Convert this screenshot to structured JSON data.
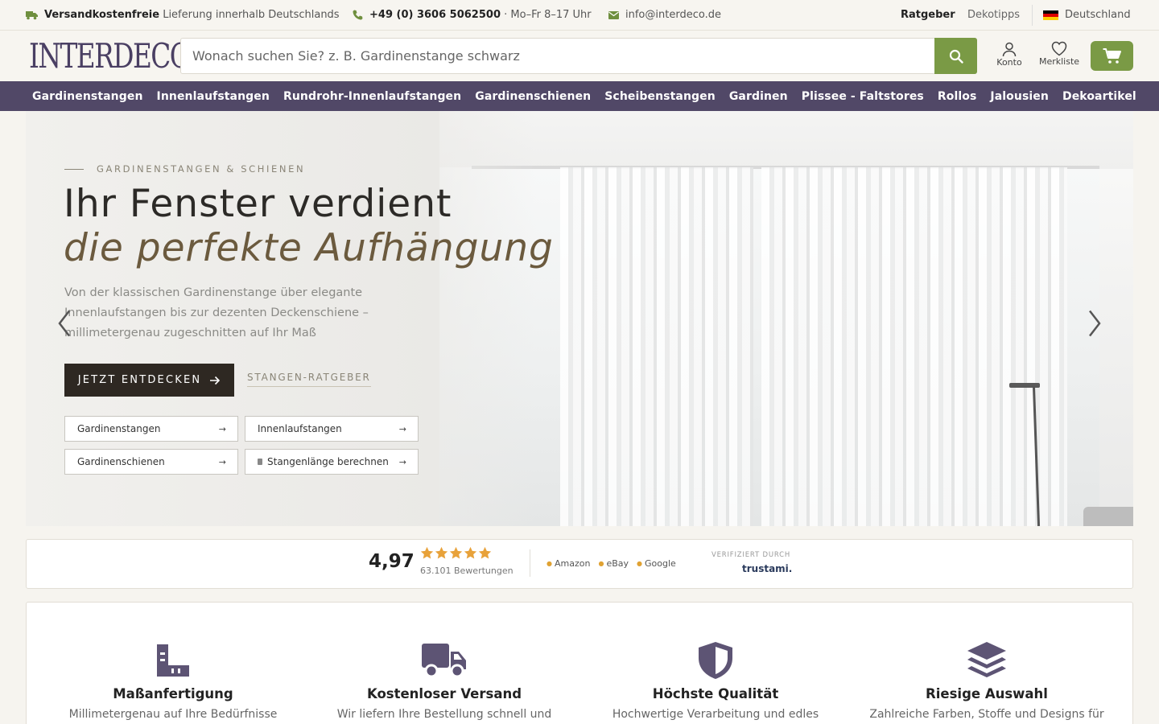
{
  "topbar": {
    "shipping_bold": "Versandkostenfreie",
    "shipping_rest": " Lieferung innerhalb Deutschlands",
    "phone": "+49 (0) 3606 5062500",
    "hours": " · Mo–Fr 8–17 Uhr",
    "email": "info@interdeco.de",
    "ratgeber": "Ratgeber",
    "dekotipps": "Dekotipps",
    "country": "Deutschland"
  },
  "header": {
    "logo": "INTERDECO",
    "search_placeholder": "Wonach suchen Sie? z. B. Gardinenstange schwarz",
    "konto": "Konto",
    "merkliste": "Merkliste"
  },
  "nav": [
    "Gardinenstangen",
    "Innenlaufstangen",
    "Rundrohr-Innenlaufstangen",
    "Gardinenschienen",
    "Scheibenstangen",
    "Gardinen",
    "Plissee - Faltstores",
    "Rollos",
    "Jalousien",
    "Dekoartikel"
  ],
  "hero": {
    "eyebrow": "GARDINENSTANGEN & SCHIENEN",
    "title_line1": "Ihr Fenster verdient",
    "title_line2": "die perfekte Aufhängung",
    "lead": "Von der klassischen Gardinenstange über elegante Innenlaufstangen bis zur dezenten Deckenschiene – millimetergenau zugeschnitten auf Ihr Maß",
    "cta": "JETZT ENTDECKEN",
    "secondary": "STANGEN-RATGEBER",
    "quick_links": [
      "Gardinenstangen",
      "Innenlaufstangen",
      "Gardinenschienen",
      "Stangenlänge berechnen"
    ]
  },
  "rating": {
    "score": "4,97",
    "stars": 5,
    "reviews": "63.101 Bewertungen",
    "sources": [
      "Amazon",
      "eBay",
      "Google"
    ],
    "verified_label": "VERIFIZIERT DURCH",
    "verifier": "trustami."
  },
  "features": [
    {
      "icon": "ruler-icon",
      "title": "Maßanfertigung",
      "desc": "Millimetergenau auf Ihre Bedürfnisse"
    },
    {
      "icon": "truck-icon",
      "title": "Kostenloser Versand",
      "desc": "Wir liefern Ihre Bestellung schnell und"
    },
    {
      "icon": "shield-icon",
      "title": "Höchste Qualität",
      "desc": "Hochwertige Verarbeitung und edles"
    },
    {
      "icon": "layers-icon",
      "title": "Riesige Auswahl",
      "desc": "Zahlreiche Farben, Stoffe und Designs für"
    }
  ],
  "colors": {
    "accent_green": "#7a9a45",
    "nav_purple": "#514867",
    "icon_purple": "#5d5474",
    "star_orange": "#e8a23a"
  }
}
